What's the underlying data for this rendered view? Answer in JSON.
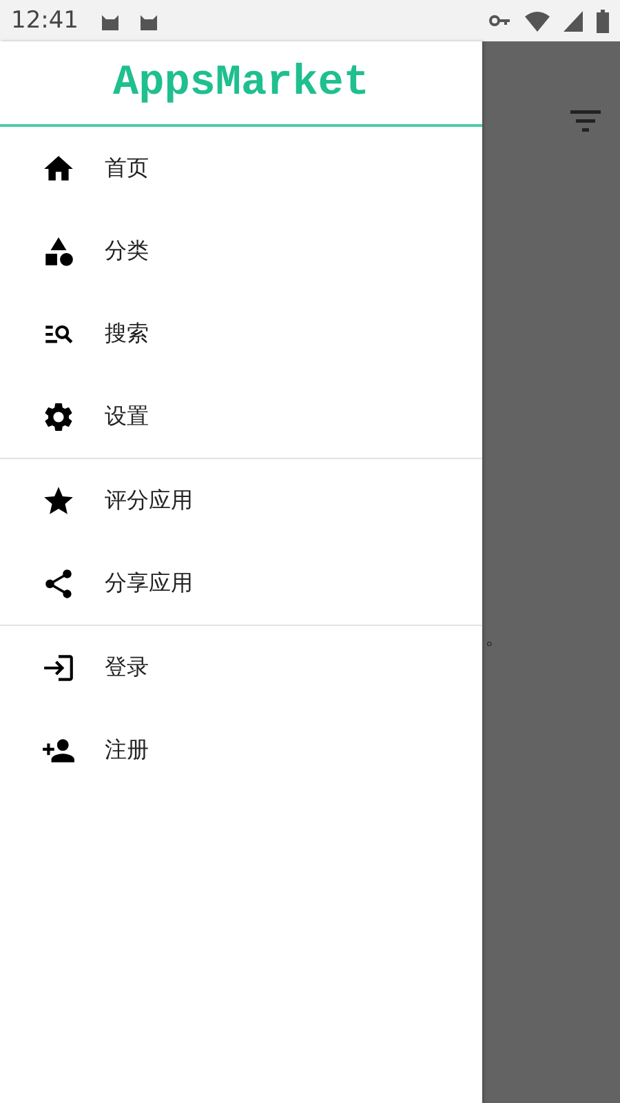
{
  "status_bar": {
    "time": "12:41"
  },
  "drawer": {
    "title": "AppsMarket",
    "sections": [
      [
        {
          "label": "首页",
          "kind": "home"
        },
        {
          "label": "分类",
          "kind": "category"
        },
        {
          "label": "搜索",
          "kind": "search"
        },
        {
          "label": "设置",
          "kind": "settings"
        }
      ],
      [
        {
          "label": "评分应用",
          "kind": "rate"
        },
        {
          "label": "分享应用",
          "kind": "share"
        }
      ],
      [
        {
          "label": "登录",
          "kind": "login"
        },
        {
          "label": "注册",
          "kind": "register"
        }
      ]
    ]
  },
  "background": {
    "partial_text": "。"
  }
}
